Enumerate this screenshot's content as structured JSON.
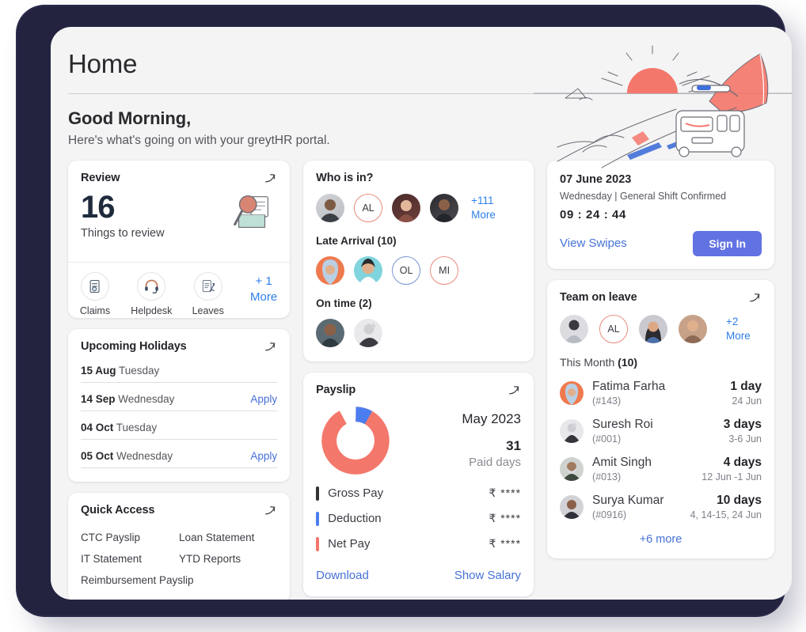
{
  "header": {
    "title": "Home",
    "greeting": "Good Morning,",
    "subtitle": "Here's what's going on with your greytHR portal.",
    "illustration": "roadtrip-sunrise-van-illustration"
  },
  "review": {
    "title": "Review",
    "count": "16",
    "count_label": "Things to review",
    "expand_icon": "arrow-up-right-icon",
    "illustration": "magnifier-envelope-illustration",
    "actions": [
      {
        "label": "Claims",
        "icon": "claims-document-icon"
      },
      {
        "label": "Helpdesk",
        "icon": "headset-icon"
      },
      {
        "label": "Leaves",
        "icon": "leaves-document-icon"
      }
    ],
    "more_line1": "+ 1",
    "more_line2": "More"
  },
  "holidays": {
    "title": "Upcoming Holidays",
    "expand_icon": "arrow-up-right-icon",
    "rows": [
      {
        "date": "15 Aug",
        "day": "Tuesday",
        "action": ""
      },
      {
        "date": "14 Sep",
        "day": "Wednesday",
        "action": "Apply"
      },
      {
        "date": "04 Oct",
        "day": "Tuesday",
        "action": ""
      },
      {
        "date": "05 Oct",
        "day": "Wednesday",
        "action": "Apply"
      }
    ]
  },
  "quick_access": {
    "title": "Quick Access",
    "expand_icon": "arrow-up-right-icon",
    "items": [
      "CTC Payslip",
      "Loan Statement",
      "IT Statement",
      "YTD Reports",
      "Reimbursement Payslip"
    ]
  },
  "who_is_in": {
    "title": "Who is in?",
    "present": [
      {
        "type": "photo",
        "name": "avatar-bearded-man"
      },
      {
        "type": "initials",
        "label": "AL",
        "ring": "coral"
      },
      {
        "type": "photo",
        "name": "avatar-woman-dark-hair"
      },
      {
        "type": "photo",
        "name": "avatar-man-dark-bg"
      }
    ],
    "present_more_line1": "+111",
    "present_more_line2": "More",
    "late_title": "Late Arrival (10)",
    "late": [
      {
        "type": "photo",
        "name": "avatar-woman-hijab"
      },
      {
        "type": "photo",
        "name": "avatar-woman-teal-bg"
      },
      {
        "type": "initials",
        "label": "OL",
        "ring": "blue"
      },
      {
        "type": "initials",
        "label": "MI",
        "ring": "coral"
      }
    ],
    "ontime_title": "On time (2)",
    "ontime": [
      {
        "type": "photo",
        "name": "avatar-smiling-man"
      },
      {
        "type": "photo",
        "name": "avatar-man-raised-hand"
      }
    ]
  },
  "payslip": {
    "title": "Payslip",
    "expand_icon": "arrow-up-right-icon",
    "month": "May 2023",
    "paid_days": "31",
    "paid_days_label": "Paid days",
    "rows": [
      {
        "label": "Gross Pay",
        "value": "₹ ****",
        "color": "#333333"
      },
      {
        "label": "Deduction",
        "value": "₹ ****",
        "color": "#4c7df0"
      },
      {
        "label": "Net Pay",
        "value": "₹ ****",
        "color": "#f4776b"
      }
    ],
    "download_label": "Download",
    "show_salary_label": "Show Salary"
  },
  "attendance": {
    "date": "07 June 2023",
    "sub": "Wednesday | General Shift Confirmed",
    "time": "09 : 24 : 44",
    "view_swipes_label": "View Swipes",
    "sign_in_label": "Sign In",
    "sign_in_color": "#6172e3"
  },
  "team_on_leave": {
    "title": "Team on leave",
    "expand_icon": "arrow-up-right-icon",
    "avatars": [
      {
        "type": "photo",
        "name": "avatar-person-grey-bg"
      },
      {
        "type": "initials",
        "label": "AL",
        "ring": "coral"
      },
      {
        "type": "photo",
        "name": "avatar-woman-long-hair"
      },
      {
        "type": "photo",
        "name": "avatar-smiling-man-tan"
      }
    ],
    "avatars_more": "+2 More",
    "month_label": "This Month",
    "month_count": "(10)",
    "rows": [
      {
        "name": "Fatima Farha",
        "id": "(#143)",
        "days": "1 day",
        "range": "24 Jun",
        "avatar": "avatar-woman-hijab"
      },
      {
        "name": "Suresh Roi",
        "id": "(#001)",
        "days": "3 days",
        "range": "3-6 Jun",
        "avatar": "avatar-man-suit"
      },
      {
        "name": "Amit Singh",
        "id": "(#013)",
        "days": "4 days",
        "range": "12 Jun -1 Jun",
        "avatar": "avatar-older-man-beard"
      },
      {
        "name": "Surya Kumar",
        "id": "(#0916)",
        "days": "10 days",
        "range": "4, 14-15, 24 Jun",
        "avatar": "avatar-young-man"
      }
    ],
    "more_label": "+6 more"
  },
  "chart_data": {
    "type": "pie",
    "title": "Payslip breakdown",
    "categories": [
      "Net Pay",
      "Deduction"
    ],
    "values": [
      92,
      8
    ],
    "colors": [
      "#f4776b",
      "#4c7df0"
    ],
    "legend": [
      "Gross Pay",
      "Deduction",
      "Net Pay"
    ],
    "donut": true
  }
}
